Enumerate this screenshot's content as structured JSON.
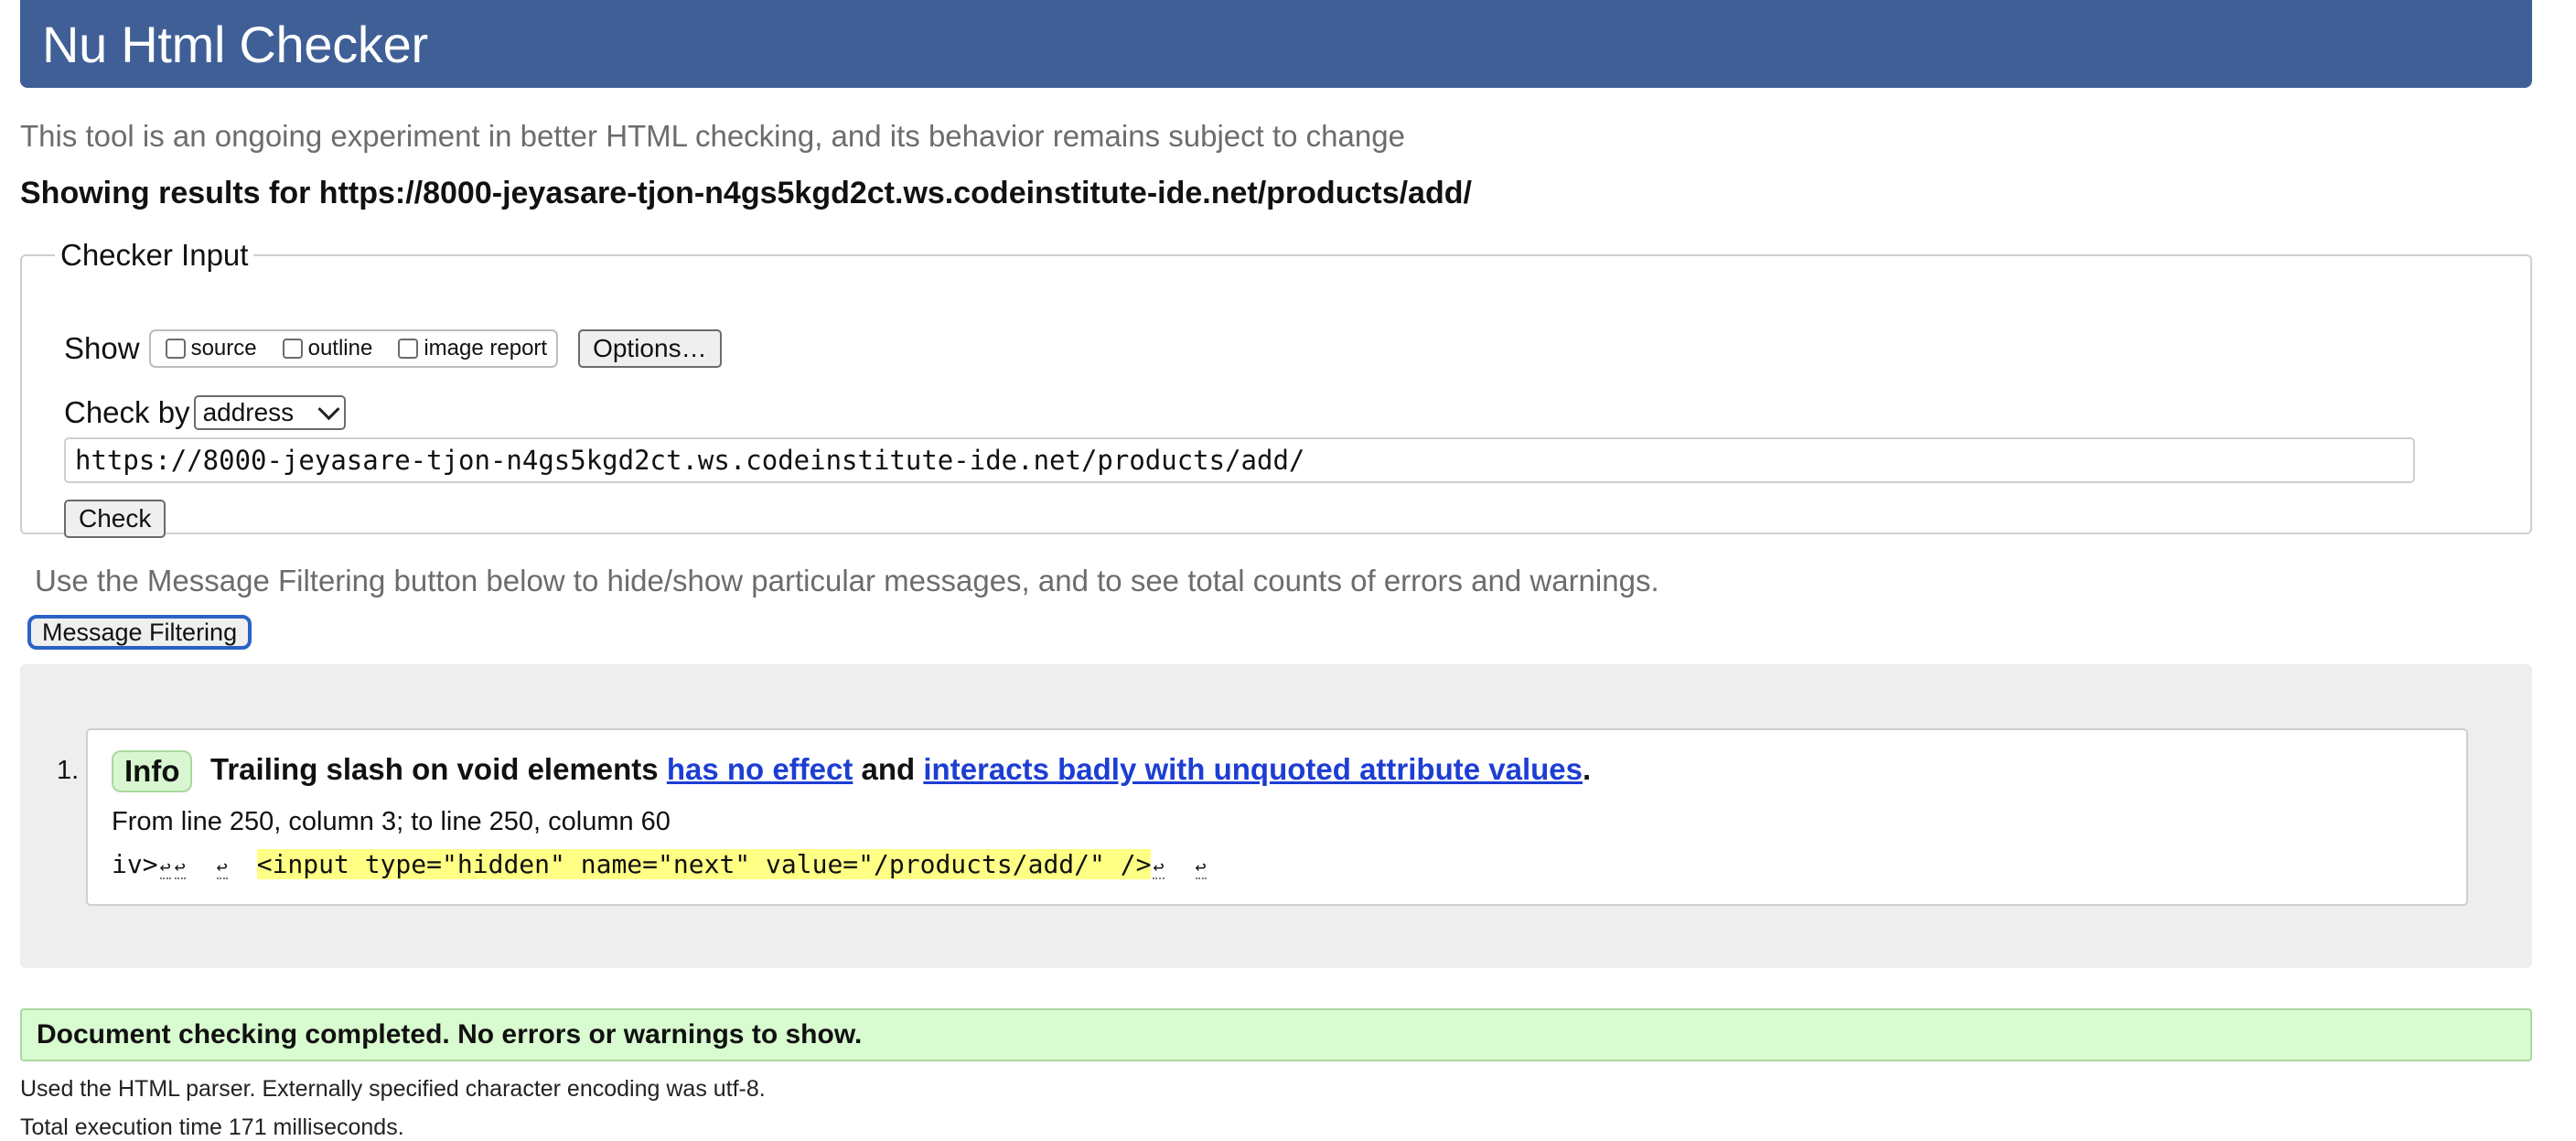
{
  "header": {
    "title": "Nu Html Checker"
  },
  "lede": "This tool is an ongoing experiment in better HTML checking, and its behavior remains subject to change",
  "showing": "Showing results for https://8000-jeyasare-tjon-n4gs5kgd2ct.ws.codeinstitute-ide.net/products/add/",
  "checker": {
    "legend": "Checker Input",
    "show_label": "Show",
    "show_options": [
      "source",
      "outline",
      "image report"
    ],
    "options_button": "Options…",
    "check_by_label": "Check by",
    "check_by_value": "address",
    "url_value": "https://8000-jeyasare-tjon-n4gs5kgd2ct.ws.codeinstitute-ide.net/products/add/",
    "check_button": "Check"
  },
  "hint": "Use the Message Filtering button below to hide/show particular messages, and to see total counts of errors and warnings.",
  "filter_button": "Message Filtering",
  "messages": [
    {
      "number": "1.",
      "type": "Info",
      "text_start": "Trailing slash on void elements ",
      "link1": "has no effect",
      "text_mid": " and ",
      "link2": "interacts badly with unquoted attribute values",
      "text_end": ".",
      "location": "From line 250, column 3; to line 250, column 60",
      "extract_prefix": "iv>",
      "extract_highlight": "<input type=\"hidden\" name=\"next\" value=\"/products/add/\" />",
      "lf_glyph": "↩"
    }
  ],
  "success": "Document checking completed. No errors or warnings to show.",
  "footer": {
    "parser_note": "Used the HTML parser. Externally specified character encoding was utf-8.",
    "execution_time": "Total execution time 171 milliseconds."
  },
  "colors": {
    "header_bg": "#3f5f96",
    "link": "#1d3ed2",
    "success_bg": "#d8fbd0",
    "highlight": "#ffff85",
    "focus_ring": "#2a63c5"
  }
}
